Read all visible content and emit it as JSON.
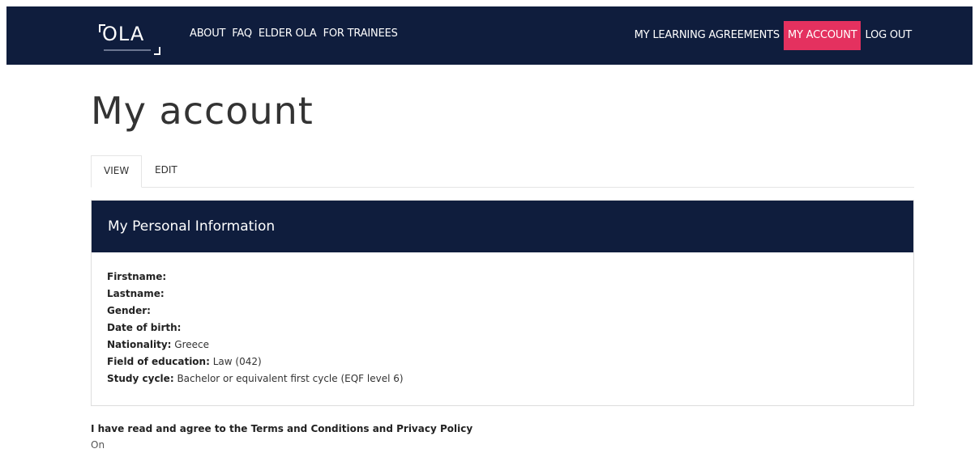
{
  "logo": {
    "text": "OLA"
  },
  "nav": {
    "left": [
      {
        "label": "ABOUT"
      },
      {
        "label": "FAQ"
      },
      {
        "label": "ELDER OLA"
      },
      {
        "label": "FOR TRAINEES"
      }
    ],
    "right": [
      {
        "label": "MY LEARNING AGREEMENTS"
      },
      {
        "label": "MY ACCOUNT"
      },
      {
        "label": "LOG OUT"
      }
    ],
    "active": "MY ACCOUNT",
    "accent_color": "#e4315f",
    "bar_color": "#0f1d3d"
  },
  "page": {
    "title": "My account"
  },
  "tabs": [
    {
      "label": "VIEW"
    },
    {
      "label": "EDIT"
    }
  ],
  "tabs_active": "VIEW",
  "panel": {
    "heading": "My Personal Information",
    "fields": [
      {
        "label": "Firstname:",
        "value": ""
      },
      {
        "label": "Lastname:",
        "value": ""
      },
      {
        "label": "Gender:",
        "value": ""
      },
      {
        "label": "Date of birth:",
        "value": ""
      },
      {
        "label": "Nationality:",
        "value": "Greece"
      },
      {
        "label": "Field of education:",
        "value": "Law (042)"
      },
      {
        "label": "Study cycle:",
        "value": "Bachelor or equivalent first cycle (EQF level 6)"
      }
    ]
  },
  "terms": {
    "label": "I have read and agree to the Terms and Conditions and Privacy Policy",
    "value": "On"
  }
}
